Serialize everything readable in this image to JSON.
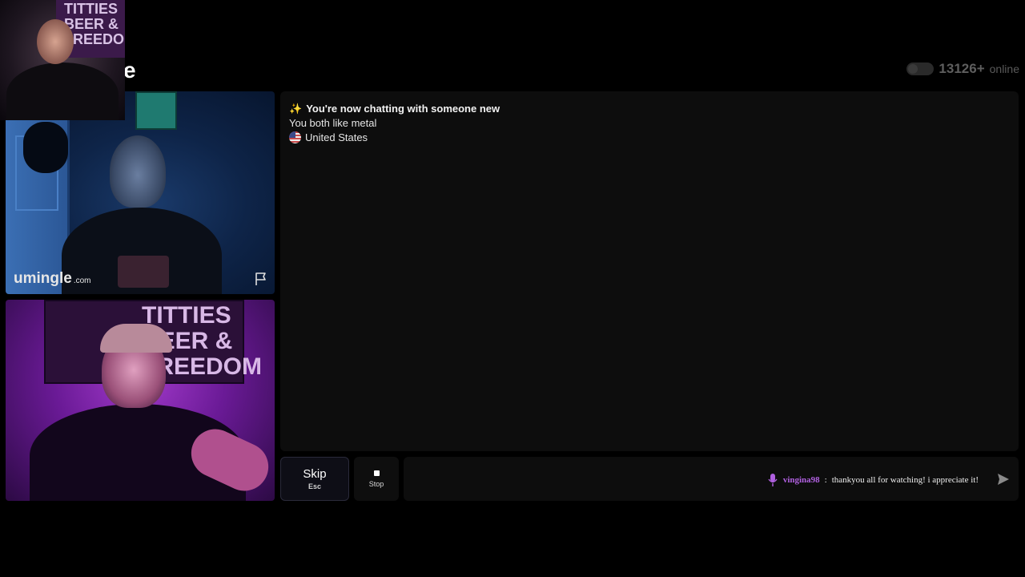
{
  "header": {
    "logo_partial": "e",
    "online_count": "13126+",
    "online_label": "online"
  },
  "stranger_video": {
    "watermark_name": "umingle",
    "watermark_tld": ".com"
  },
  "self_video": {
    "sign_text": "TITTIES BEER & FREEDOM"
  },
  "pip_overlay": {
    "sign_text": "TITTIES BEER & FREEDOM"
  },
  "chat": {
    "messages": [
      "✨",
      "You're now chatting with someone new",
      "You both like metal",
      "United States"
    ]
  },
  "controls": {
    "skip_label": "Skip",
    "skip_shortcut": "Esc",
    "stop_label": "Stop",
    "input_value": "",
    "input_placeholder": ""
  },
  "stream_overlay": {
    "username": "vingina98",
    "separator": ":",
    "message": "thankyou all for watching! i appreciate it!"
  },
  "colors": {
    "background": "#000000",
    "panel": "#0d0d0d",
    "username_accent": "#b060e0",
    "sparkle": "#f2c94c"
  },
  "icons": {
    "sparkle": "sparkles-icon",
    "flag": "us-flag-icon",
    "report": "report-flag-icon",
    "stop": "stop-square-icon",
    "mic": "microphone-icon",
    "send": "send-icon",
    "toggle": "toggle-icon"
  }
}
